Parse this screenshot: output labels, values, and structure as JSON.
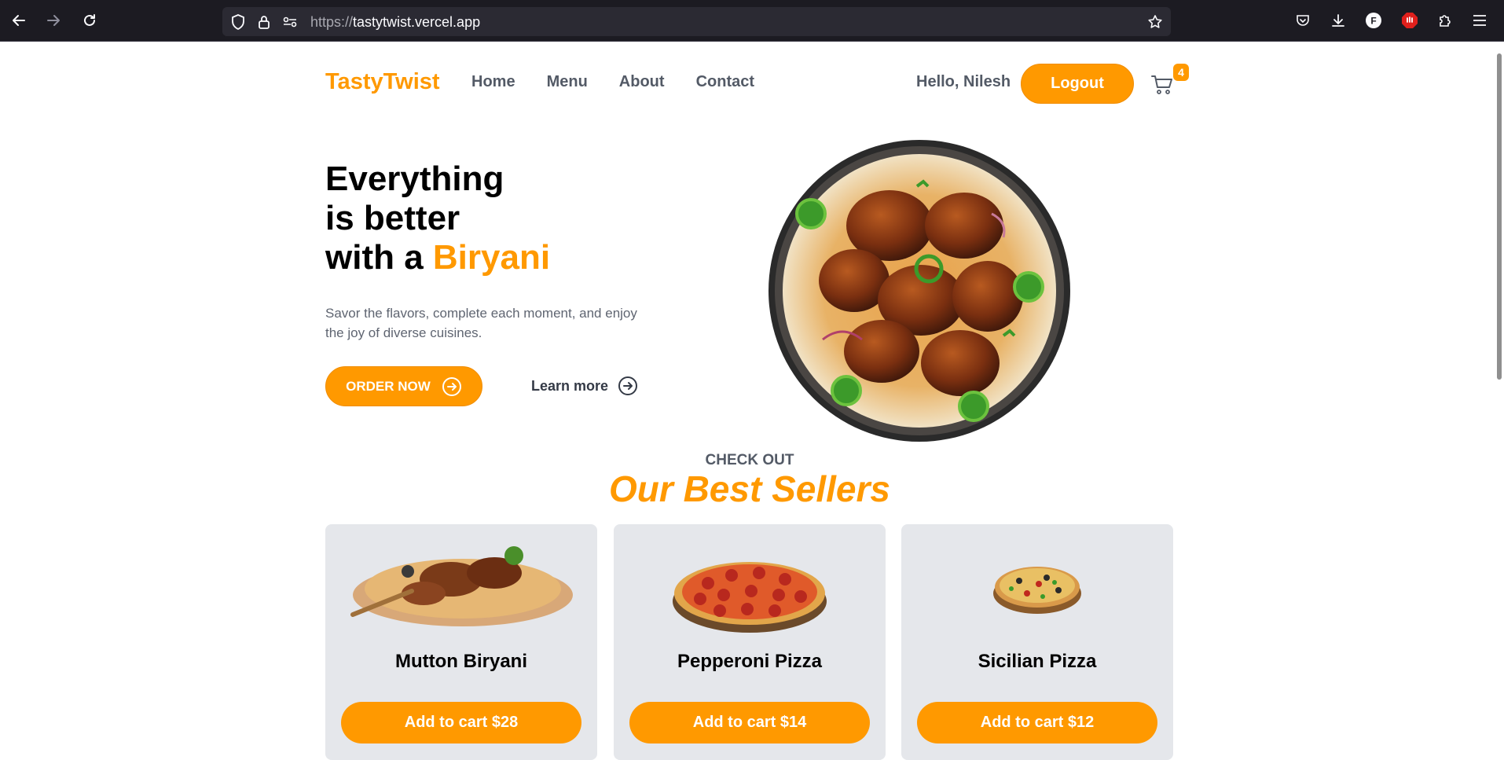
{
  "browser": {
    "url_scheme": "https://",
    "url_host": "tastytwist.vercel.app"
  },
  "header": {
    "logo": "TastyTwist",
    "nav": [
      "Home",
      "Menu",
      "About",
      "Contact"
    ],
    "greeting": "Hello, Nilesh",
    "logout_label": "Logout",
    "cart_count": "4"
  },
  "hero": {
    "title_line1": "Everything",
    "title_line2": "is better",
    "title_line3_prefix": "with a ",
    "title_accent": "Biryani",
    "subtitle": "Savor the flavors, complete each moment, and enjoy the joy of diverse cuisines.",
    "order_label": "ORDER NOW",
    "learn_label": "Learn more"
  },
  "best_sellers": {
    "kicker": "CHECK OUT",
    "title": "Our Best Sellers",
    "items": [
      {
        "name": "Mutton Biryani",
        "button": "Add to cart $28"
      },
      {
        "name": "Pepperoni Pizza",
        "button": "Add to cart $14"
      },
      {
        "name": "Sicilian Pizza",
        "button": "Add to cart $12"
      }
    ]
  },
  "colors": {
    "accent": "#ff9900",
    "chrome_bg": "#1c1b22",
    "card_bg": "#e5e7eb"
  }
}
